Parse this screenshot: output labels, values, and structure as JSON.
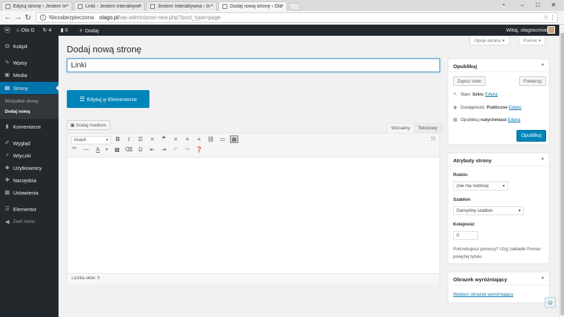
{
  "browser": {
    "tabs": [
      {
        "label": "Edytuj stronę ‹ Jestem In"
      },
      {
        "label": "Linki - Jestem Interaktywn"
      },
      {
        "label": "Jestem Interaktywna › In"
      },
      {
        "label": "Dodaj nową stronę ‹ Ola"
      }
    ],
    "close_glyph": "×",
    "address": {
      "security": "Niezabezpieczona",
      "domain": "olago.pl",
      "path": "/wp-admin/post-new.php?post_type=page"
    }
  },
  "adminbar": {
    "site": "Ola G",
    "updates": "4",
    "comments": "0",
    "new": "Dodaj",
    "greeting": "Witaj, olagosciniak"
  },
  "sidebar": {
    "items": [
      {
        "label": "Kokpit",
        "icon": "dashboard-icon"
      },
      {
        "label": "Wpisy",
        "icon": "pin-icon"
      },
      {
        "label": "Media",
        "icon": "media-icon"
      },
      {
        "label": "Strony",
        "icon": "pages-icon"
      },
      {
        "label": "Komentarze",
        "icon": "comment-icon"
      },
      {
        "label": "Wygląd",
        "icon": "brush-icon"
      },
      {
        "label": "Wtyczki",
        "icon": "plugin-icon"
      },
      {
        "label": "Użytkownicy",
        "icon": "users-icon"
      },
      {
        "label": "Narzędzia",
        "icon": "wrench-icon"
      },
      {
        "label": "Ustawienia",
        "icon": "settings-icon"
      },
      {
        "label": "Elementor",
        "icon": "elementor-icon"
      },
      {
        "label": "Zwiń menu",
        "icon": "collapse-icon"
      }
    ],
    "submenu": [
      "Wszystkie strony",
      "Dodaj nową"
    ]
  },
  "screen_options": "Opcje ekranu",
  "help": "Pomoc",
  "page_title": "Dodaj nową stronę",
  "title_value": "Linki",
  "elementor_button": "Edytuj w Elementorze",
  "editor": {
    "add_media": "Dodaj medium",
    "tab_visual": "Wizualny",
    "tab_text": "Tekstowy",
    "format": "Akapit",
    "word_count": "Liczba słów: 0"
  },
  "publish_box": {
    "title": "Opublikuj",
    "save_draft": "Zapisz szkic",
    "preview": "Podejrzyj",
    "status_label": "Stan:",
    "status_value": "Szkic",
    "visibility_label": "Dostępność:",
    "visibility_value": "Publiczne",
    "publish_label": "Opublikuj",
    "publish_value": "natychmiast",
    "edit": "Edytuj",
    "publish_button": "Opublikuj"
  },
  "attributes_box": {
    "title": "Atrybuty strony",
    "parent_label": "Rodzic",
    "parent_value": "(nie ma rodzica)",
    "template_label": "Szablon",
    "template_value": "Domyślny szablon",
    "order_label": "Kolejność",
    "order_value": "0",
    "help_text_1": "Potrzebujesz pomocy? Użyj zakładki Pomoc",
    "help_text_2": "powyżej tytułu."
  },
  "featured_box": {
    "title": "Obrazek wyróżniający",
    "link": "Wybierz obrazek wyróżniający"
  },
  "colors": {
    "accent": "#0085ba",
    "sidebar": "#23282d",
    "link": "#0073aa"
  }
}
